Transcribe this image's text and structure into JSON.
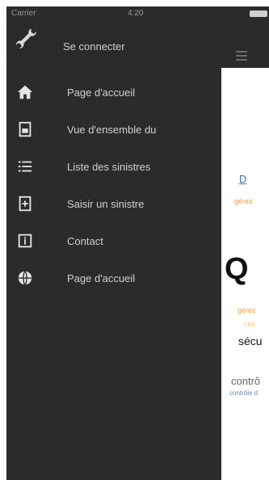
{
  "status_bar": {
    "carrier": "Carrier",
    "time": "4:20"
  },
  "top_bar": {
    "login_label": "Se connecter"
  },
  "menu": {
    "items": [
      {
        "icon": "home-icon",
        "label": "Page d'accueil"
      },
      {
        "icon": "document-icon",
        "label": "Vue d'ensemble du"
      },
      {
        "icon": "list-icon",
        "label": "Liste des sinistres"
      },
      {
        "icon": "add-document-icon",
        "label": "Saisir un sinistre"
      },
      {
        "icon": "info-icon",
        "label": "Contact"
      },
      {
        "icon": "globe-icon",
        "label": "Page d'accueil"
      }
    ]
  },
  "content": {
    "fragment_1": "D",
    "fragment_2": "gérez",
    "fragment_3": "Q",
    "fragment_4": "gérez",
    "fragment_5": "ces",
    "fragment_6": "sécu",
    "fragment_7": "contrô",
    "fragment_8": "contrôle d"
  },
  "colors": {
    "drawer_bg": "#2b2b2b",
    "menu_text": "#cfcfcf",
    "content_bg": "#ffffff",
    "accent_orange": "#f19a2f",
    "link_blue": "#3a6ea8"
  }
}
